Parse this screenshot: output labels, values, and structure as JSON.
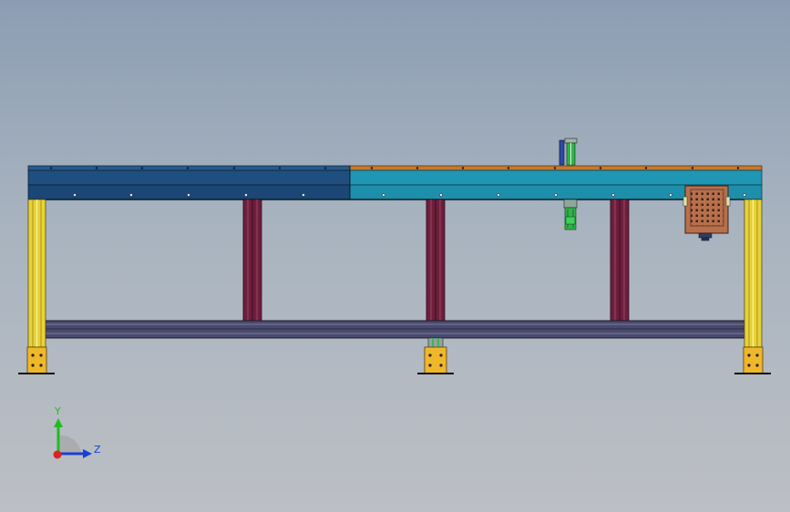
{
  "triad": {
    "y_label": "Y",
    "z_label": "Z",
    "colors": {
      "y": "#22bb22",
      "z": "#1a3fd6",
      "x": "#dd2222"
    }
  },
  "colors": {
    "frame_top_left": "#1f4f7e",
    "frame_top_right": "#1f97b4",
    "top_strip_right": "#c67a2c",
    "post": "#e8d23a",
    "post_bracket": "#efb72a",
    "middle_post": "#6e1f3c",
    "lower_rail": "#4a4a6e",
    "motor_green": "#2fb34a",
    "control_box": "#b86f4c"
  }
}
